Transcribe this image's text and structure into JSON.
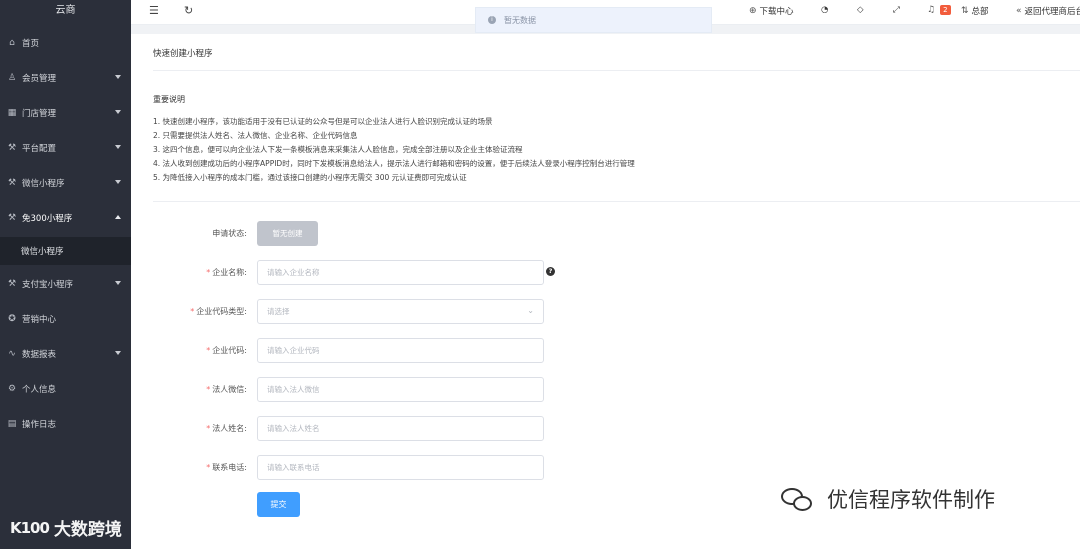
{
  "sidebar": {
    "brand": "云商",
    "items": [
      {
        "icon": "home-icon",
        "glyph": "⌂",
        "label": "首页",
        "has_caret": false
      },
      {
        "icon": "user-icon",
        "glyph": "♙",
        "label": "会员管理",
        "has_caret": true
      },
      {
        "icon": "store-icon",
        "glyph": "▦",
        "label": "门店管理",
        "has_caret": true
      },
      {
        "icon": "platform-icon",
        "glyph": "⚒",
        "label": "平台配置",
        "has_caret": true
      },
      {
        "icon": "wechat-app-icon",
        "glyph": "⚒",
        "label": "微信小程序",
        "has_caret": true
      },
      {
        "icon": "free-app-icon",
        "glyph": "⚒",
        "label": "免300小程序",
        "has_caret": true,
        "expanded": true
      },
      {
        "icon": "alipay-icon",
        "glyph": "⚒",
        "label": "支付宝小程序",
        "has_caret": true
      },
      {
        "icon": "marketing-icon",
        "glyph": "✪",
        "label": "营销中心",
        "has_caret": false
      },
      {
        "icon": "report-icon",
        "glyph": "∿",
        "label": "数据报表",
        "has_caret": true
      },
      {
        "icon": "profile-icon",
        "glyph": "⚙",
        "label": "个人信息",
        "has_caret": false
      },
      {
        "icon": "log-icon",
        "glyph": "▤",
        "label": "操作日志",
        "has_caret": false
      }
    ],
    "sub_item": "微信小程序"
  },
  "topbar": {
    "menu_glyph": "☰",
    "refresh_glyph": "↻",
    "download_label": "下载中心",
    "notification_count": "2",
    "account_label": "总部",
    "back_label": "返回代理商后台"
  },
  "toast": {
    "text": "暂无数据"
  },
  "page": {
    "title": "快速创建小程序",
    "notes_title": "重要说明",
    "notes": [
      "1. 快速创建小程序，该功能适用于没有已认证的公众号但是可以企业法人进行人脸识别完成认证的场景",
      "2. 只需要提供法人姓名、法人微信、企业名称、企业代码信息",
      "3. 这四个信息，便可以向企业法人下发一条模板消息来采集法人人脸信息，完成全部注册以及企业主体验证流程",
      "4. 法人收到创建成功后的小程序APPID时，同时下发模板消息给法人，提示法人进行邮箱和密码的设置，便于后续法人登录小程序控制台进行管理",
      "5. 为降低接入小程序的成本门槛，通过该接口创建的小程序无需交 300 元认证费即可完成认证"
    ]
  },
  "form": {
    "status_label": "申请状态:",
    "status_value": "暂无创建",
    "company_name_label": "企业名称:",
    "company_name_placeholder": "请输入企业名称",
    "code_type_label": "企业代码类型:",
    "code_type_placeholder": "请选择",
    "code_label": "企业代码:",
    "code_placeholder": "请输入企业代码",
    "legal_wechat_label": "法人微信:",
    "legal_wechat_placeholder": "请输入法人微信",
    "legal_name_label": "法人姓名:",
    "legal_name_placeholder": "请输入法人姓名",
    "phone_label": "联系电话:",
    "phone_placeholder": "请输入联系电话",
    "required_mark": "*",
    "submit_label": "提交"
  },
  "watermarks": {
    "left_logo": "K100",
    "left_text": "大数跨境",
    "right_text": "优信程序软件制作"
  }
}
